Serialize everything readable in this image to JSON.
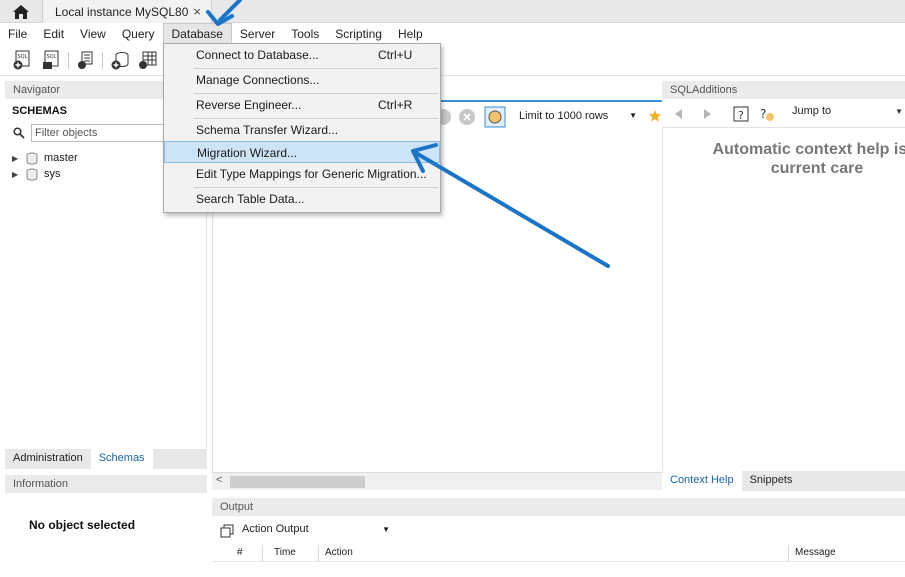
{
  "tabs": {
    "home_icon": "home-icon",
    "connection_title": "Local instance MySQL80",
    "close_glyph": "×"
  },
  "menubar": {
    "items": [
      "File",
      "Edit",
      "View",
      "Query",
      "Database",
      "Server",
      "Tools",
      "Scripting",
      "Help"
    ],
    "active": "Database"
  },
  "database_menu": {
    "items": [
      {
        "label": "Connect to Database...",
        "shortcut": "Ctrl+U"
      },
      {
        "label": "Manage Connections...",
        "shortcut": ""
      },
      {
        "label": "Reverse Engineer...",
        "shortcut": "Ctrl+R"
      },
      {
        "label": "Schema Transfer Wizard...",
        "shortcut": ""
      },
      {
        "label": "Migration Wizard...",
        "shortcut": "",
        "highlighted": true
      },
      {
        "label": "Edit Type Mappings for Generic Migration...",
        "shortcut": ""
      },
      {
        "label": "Search Table Data...",
        "shortcut": ""
      }
    ]
  },
  "navigator": {
    "header": "Navigator",
    "schemas_label": "SCHEMAS",
    "filter_placeholder": "Filter objects",
    "schemas": [
      "master",
      "sys"
    ],
    "tabs": [
      "Administration",
      "Schemas"
    ],
    "selected_tab": "Schemas"
  },
  "information": {
    "header": "Information",
    "message": "No object selected"
  },
  "editor": {
    "limit_label": "Limit to 1000 rows"
  },
  "sql_additions": {
    "header": "SQLAdditions",
    "jump_to": "Jump to",
    "help_line1": "Automatic context help is d",
    "help_line2": "current care",
    "tabs": [
      "Context Help",
      "Snippets"
    ],
    "selected_tab": "Context Help"
  },
  "output": {
    "header": "Output",
    "selector": "Action Output",
    "columns": [
      "#",
      "Time",
      "Action",
      "Message"
    ]
  },
  "colors": {
    "accent": "#1a63a8",
    "annotation_arrow": "#1a75c9",
    "menu_highlight": "#cde4f7"
  }
}
